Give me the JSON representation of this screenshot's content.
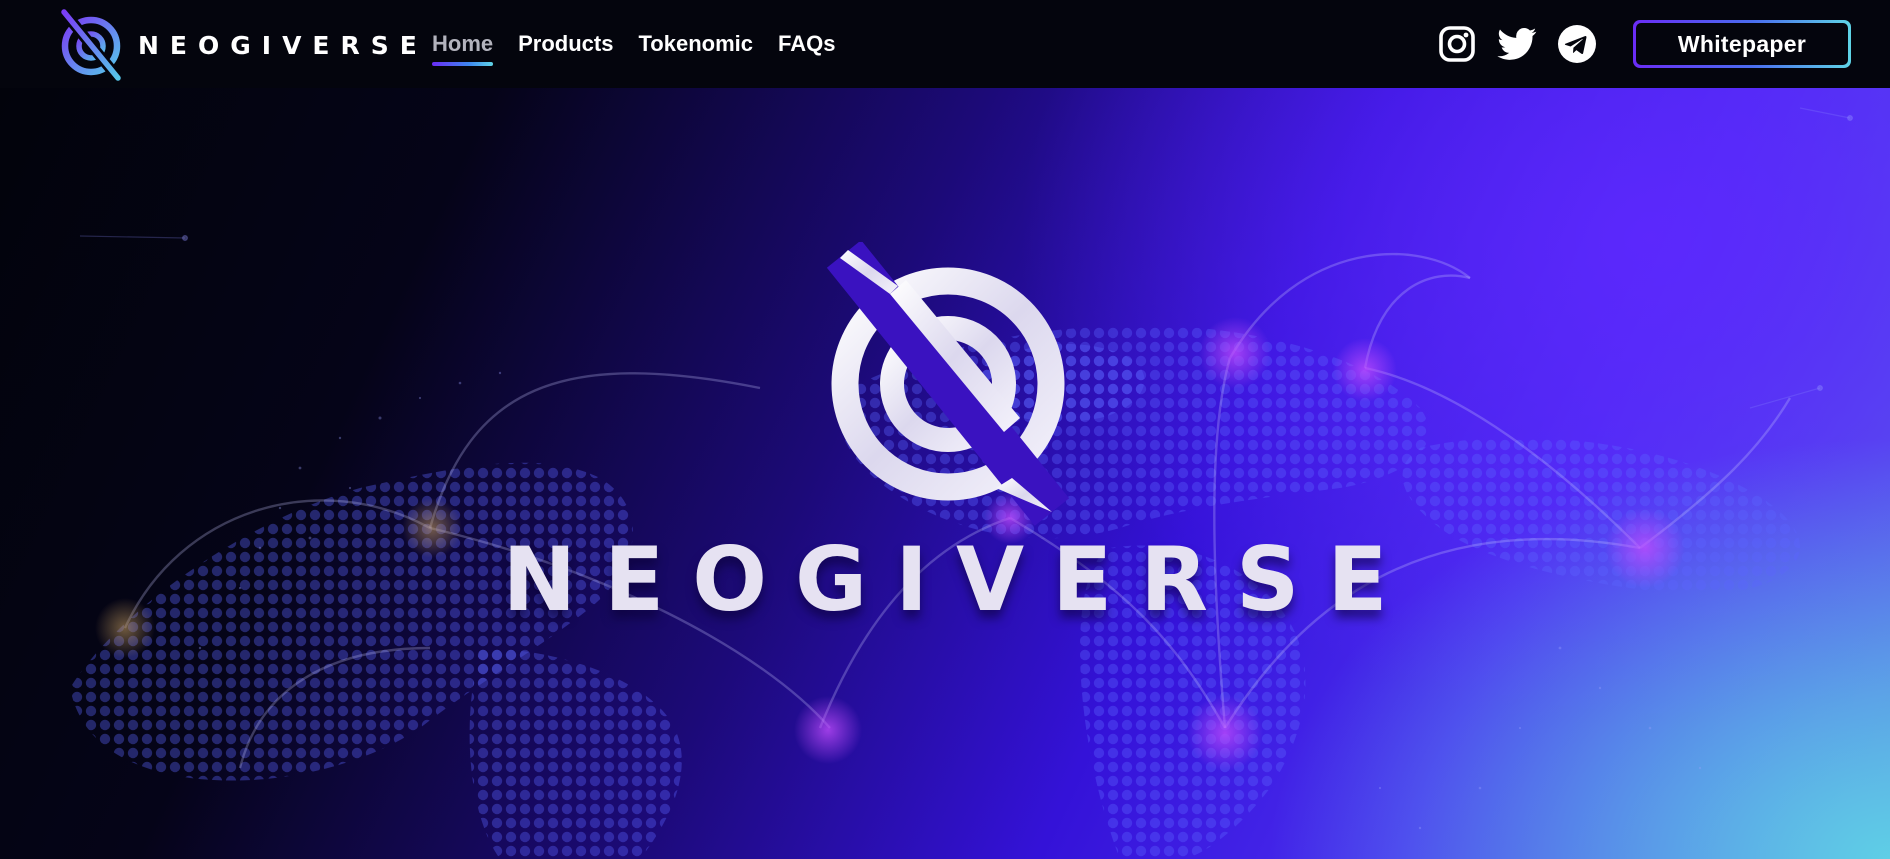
{
  "brand": {
    "name": "NEOGIVERSE",
    "logo_icon": "neogiverse-logo-icon"
  },
  "nav": {
    "items": [
      {
        "label": "Home",
        "active": true
      },
      {
        "label": "Products",
        "active": false
      },
      {
        "label": "Tokenomic",
        "active": false
      },
      {
        "label": "FAQs",
        "active": false
      }
    ]
  },
  "socials": [
    {
      "icon": "instagram-icon"
    },
    {
      "icon": "twitter-icon"
    },
    {
      "icon": "telegram-icon"
    }
  ],
  "header": {
    "whitepaper_label": "Whitepaper"
  },
  "hero": {
    "title": "NEOGIVERSE",
    "logo_icon": "neogiverse-logo-icon"
  },
  "colors": {
    "nav_bg": "#04050d",
    "accent_purple": "#6a2cf5",
    "accent_cyan": "#5fd4e6",
    "hero_text": "#e6e2f2",
    "active_nav": "#b3b3bd"
  }
}
